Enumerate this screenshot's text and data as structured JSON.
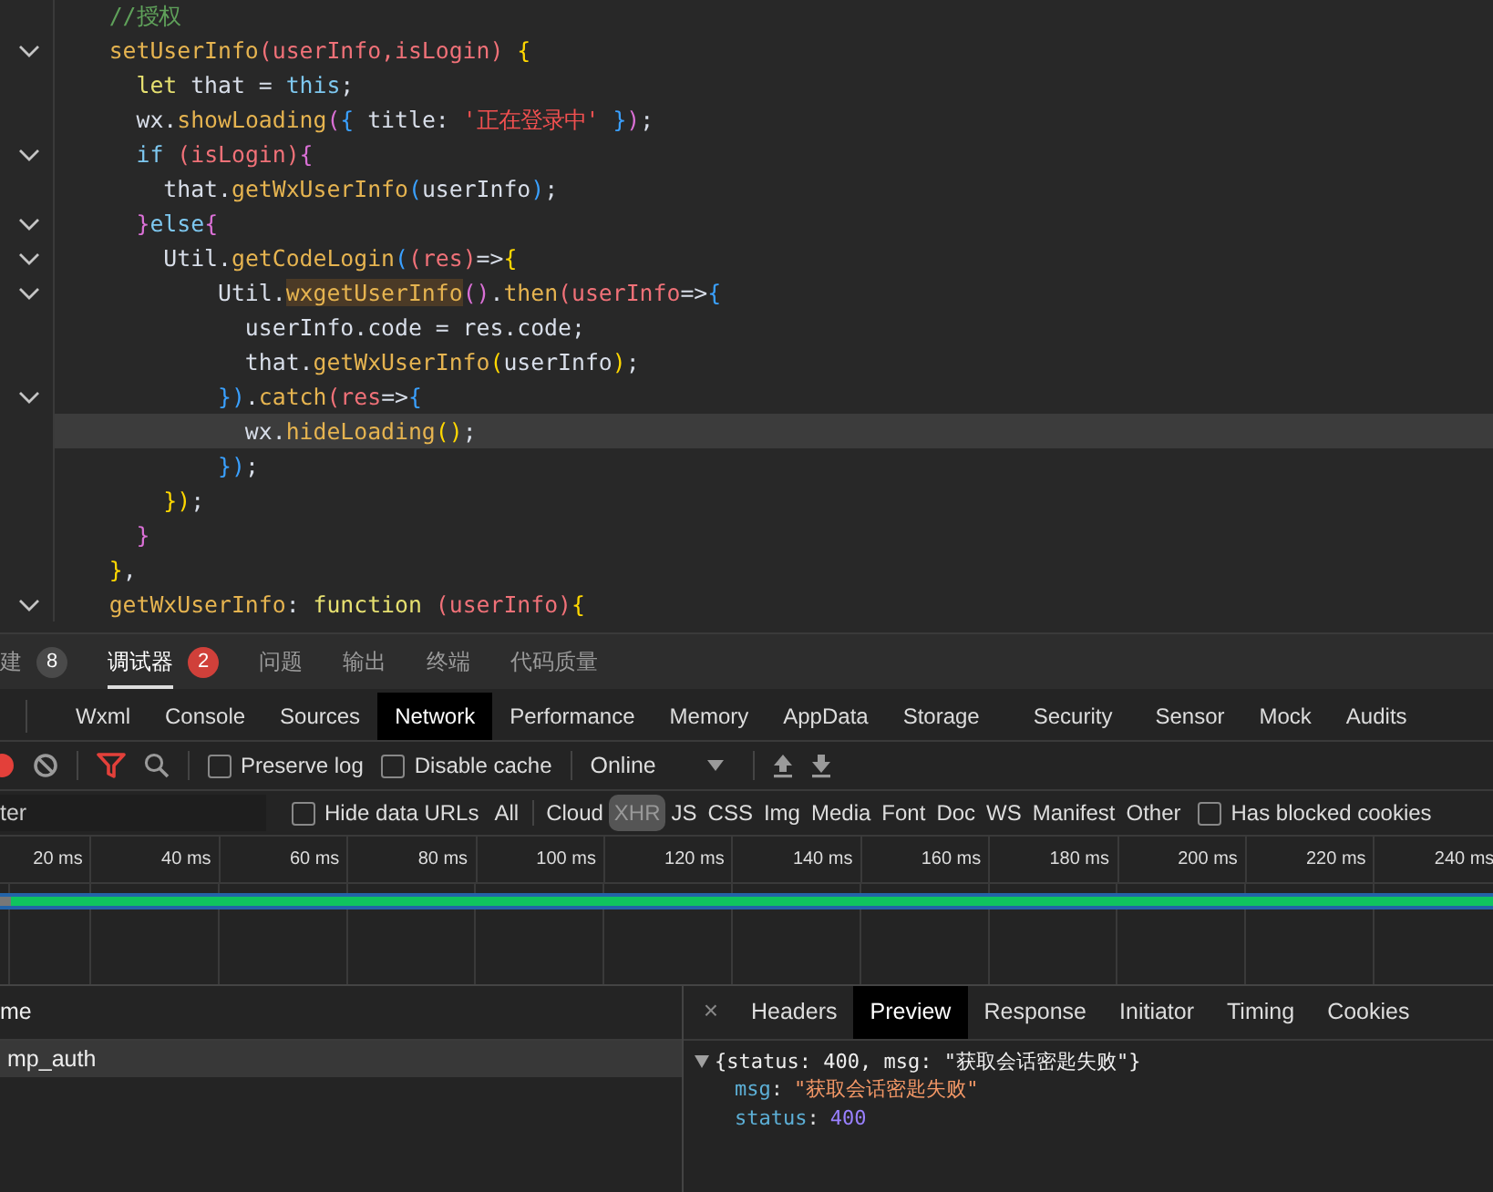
{
  "editor": {
    "lines": [
      {
        "fold": false,
        "current": false,
        "tokens": [
          {
            "text": "    //授权",
            "kind": "comment"
          }
        ]
      },
      {
        "fold": true,
        "current": false,
        "tokens": [
          {
            "text": "    setUserInfo",
            "kind": "func"
          },
          {
            "text": "(userInfo,isLogin)",
            "kind": "param"
          },
          {
            "text": " {",
            "kind": "b1"
          }
        ]
      },
      {
        "fold": false,
        "current": false,
        "tokens": [
          {
            "text": "      let",
            "kind": "keyword"
          },
          {
            "text": " that = ",
            "kind": "plain"
          },
          {
            "text": "this",
            "kind": "this"
          },
          {
            "text": ";",
            "kind": "plain"
          }
        ]
      },
      {
        "fold": false,
        "current": false,
        "tokens": [
          {
            "text": "      wx.",
            "kind": "plain"
          },
          {
            "text": "showLoading",
            "kind": "func"
          },
          {
            "text": "(",
            "kind": "b2"
          },
          {
            "text": "{",
            "kind": "b3"
          },
          {
            "text": " title: ",
            "kind": "plain"
          },
          {
            "text": "'正在登录中'",
            "kind": "string"
          },
          {
            "text": " }",
            "kind": "b3"
          },
          {
            "text": ")",
            "kind": "b2"
          },
          {
            "text": ";",
            "kind": "plain"
          }
        ]
      },
      {
        "fold": true,
        "current": false,
        "tokens": [
          {
            "text": "      if",
            "kind": "this"
          },
          {
            "text": " (isLogin)",
            "kind": "param"
          },
          {
            "text": "{",
            "kind": "b2"
          }
        ]
      },
      {
        "fold": false,
        "current": false,
        "tokens": [
          {
            "text": "        that.",
            "kind": "plain"
          },
          {
            "text": "getWxUserInfo",
            "kind": "func"
          },
          {
            "text": "(",
            "kind": "b3"
          },
          {
            "text": "userInfo",
            "kind": "plain"
          },
          {
            "text": ")",
            "kind": "b3"
          },
          {
            "text": ";",
            "kind": "plain"
          }
        ]
      },
      {
        "fold": true,
        "current": false,
        "tokens": [
          {
            "text": "      }",
            "kind": "b2"
          },
          {
            "text": "else",
            "kind": "this"
          },
          {
            "text": "{",
            "kind": "b2"
          }
        ]
      },
      {
        "fold": true,
        "current": false,
        "tokens": [
          {
            "text": "        Util.",
            "kind": "plain"
          },
          {
            "text": "getCodeLogin",
            "kind": "func"
          },
          {
            "text": "(",
            "kind": "b3"
          },
          {
            "text": "(res)",
            "kind": "param"
          },
          {
            "text": "=>",
            "kind": "plain"
          },
          {
            "text": "{",
            "kind": "b1"
          }
        ]
      },
      {
        "fold": true,
        "current": false,
        "tokens": [
          {
            "text": "            Util.",
            "kind": "plain"
          },
          {
            "text": "wxgetUserInfo",
            "kind": "match"
          },
          {
            "text": "()",
            "kind": "b2"
          },
          {
            "text": ".",
            "kind": "plain"
          },
          {
            "text": "then",
            "kind": "func"
          },
          {
            "text": "(userInfo",
            "kind": "param"
          },
          {
            "text": "=>",
            "kind": "plain"
          },
          {
            "text": "{",
            "kind": "b3"
          }
        ]
      },
      {
        "fold": false,
        "current": false,
        "tokens": [
          {
            "text": "              userInfo.code = res.code;",
            "kind": "plain"
          }
        ]
      },
      {
        "fold": false,
        "current": false,
        "tokens": [
          {
            "text": "              that.",
            "kind": "plain"
          },
          {
            "text": "getWxUserInfo",
            "kind": "func"
          },
          {
            "text": "(",
            "kind": "b1"
          },
          {
            "text": "userInfo",
            "kind": "plain"
          },
          {
            "text": ")",
            "kind": "b1"
          },
          {
            "text": ";",
            "kind": "plain"
          }
        ]
      },
      {
        "fold": true,
        "current": false,
        "tokens": [
          {
            "text": "            })",
            "kind": "b3"
          },
          {
            "text": ".",
            "kind": "plain"
          },
          {
            "text": "catch",
            "kind": "func"
          },
          {
            "text": "(res",
            "kind": "param"
          },
          {
            "text": "=>",
            "kind": "plain"
          },
          {
            "text": "{",
            "kind": "b3"
          }
        ]
      },
      {
        "fold": false,
        "current": true,
        "tokens": [
          {
            "text": "              wx.",
            "kind": "plain"
          },
          {
            "text": "hideLoading",
            "kind": "func"
          },
          {
            "text": "()",
            "kind": "b1"
          },
          {
            "text": ";",
            "kind": "plain"
          }
        ]
      },
      {
        "fold": false,
        "current": false,
        "tokens": [
          {
            "text": "            })",
            "kind": "b3"
          },
          {
            "text": ";",
            "kind": "plain"
          }
        ]
      },
      {
        "fold": false,
        "current": false,
        "tokens": [
          {
            "text": "        })",
            "kind": "b1"
          },
          {
            "text": ";",
            "kind": "plain"
          }
        ]
      },
      {
        "fold": false,
        "current": false,
        "tokens": [
          {
            "text": "      }",
            "kind": "b2"
          }
        ]
      },
      {
        "fold": false,
        "current": false,
        "tokens": [
          {
            "text": "    }",
            "kind": "b1"
          },
          {
            "text": ",",
            "kind": "plain"
          }
        ]
      },
      {
        "fold": true,
        "current": false,
        "tokens": [
          {
            "text": "    getWxUserInfo",
            "kind": "func"
          },
          {
            "text": ": ",
            "kind": "plain"
          },
          {
            "text": "function",
            "kind": "keyword"
          },
          {
            "text": " (userInfo)",
            "kind": "param"
          },
          {
            "text": "{",
            "kind": "b1"
          }
        ]
      }
    ]
  },
  "panel_tabs": [
    {
      "label": "建",
      "badge": "8",
      "color": "#4a4a4a",
      "selected": false
    },
    {
      "label": "调试器",
      "badge": "2",
      "color": "#d0403a",
      "selected": true
    },
    {
      "label": "问题",
      "selected": false
    },
    {
      "label": "输出",
      "selected": false
    },
    {
      "label": "终端",
      "selected": false
    },
    {
      "label": "代码质量",
      "selected": false
    }
  ],
  "devtools_tabs": [
    {
      "label": "Wxml",
      "selected": false
    },
    {
      "label": "Console",
      "selected": false
    },
    {
      "label": "Sources",
      "selected": false
    },
    {
      "label": "Network",
      "selected": true
    },
    {
      "label": "Performance",
      "selected": false
    },
    {
      "label": "Memory",
      "selected": false
    },
    {
      "label": "AppData",
      "selected": false
    },
    {
      "label": "Storage",
      "selected": false
    },
    {
      "label": "Security",
      "selected": false
    },
    {
      "label": "Sensor",
      "selected": false
    },
    {
      "label": "Mock",
      "selected": false
    },
    {
      "label": "Audits",
      "selected": false
    }
  ],
  "toolbar": {
    "preserve_log": {
      "label": "Preserve log",
      "checked": false
    },
    "disable_cache": {
      "label": "Disable cache",
      "checked": false
    },
    "throttling": "Online"
  },
  "filter": {
    "placeholder": "ter",
    "hide_data_urls": {
      "label": "Hide data URLs",
      "checked": false
    },
    "types": [
      {
        "label": "All",
        "selected": false
      },
      {
        "label": "Cloud",
        "selected": false
      },
      {
        "label": "XHR",
        "selected": true
      },
      {
        "label": "JS",
        "selected": false
      },
      {
        "label": "CSS",
        "selected": false
      },
      {
        "label": "Img",
        "selected": false
      },
      {
        "label": "Media",
        "selected": false
      },
      {
        "label": "Font",
        "selected": false
      },
      {
        "label": "Doc",
        "selected": false
      },
      {
        "label": "WS",
        "selected": false
      },
      {
        "label": "Manifest",
        "selected": false
      },
      {
        "label": "Other",
        "selected": false
      }
    ],
    "has_blocked_cookies": {
      "label": "Has blocked cookies",
      "checked": false
    }
  },
  "timeline": {
    "ticks": [
      "20 ms",
      "40 ms",
      "60 ms",
      "80 ms",
      "100 ms",
      "120 ms",
      "140 ms",
      "160 ms",
      "180 ms",
      "200 ms",
      "220 ms",
      "240 ms"
    ]
  },
  "requests": {
    "column": "me",
    "rows": [
      {
        "name": "mp_auth",
        "selected": true
      }
    ]
  },
  "details": {
    "close": "×",
    "tabs": [
      {
        "label": "Headers",
        "selected": false
      },
      {
        "label": "Preview",
        "selected": true
      },
      {
        "label": "Response",
        "selected": false
      },
      {
        "label": "Initiator",
        "selected": false
      },
      {
        "label": "Timing",
        "selected": false
      },
      {
        "label": "Cookies",
        "selected": false
      }
    ],
    "preview": {
      "summary": "{status: 400, msg: \"获取会话密匙失败\"}",
      "expanded": true,
      "fields": [
        {
          "key": "msg",
          "separator": ":",
          "value": "\"获取会话密匙失败\"",
          "kind": "string"
        },
        {
          "key": "status",
          "separator": ":",
          "value": "400",
          "kind": "number"
        }
      ]
    }
  }
}
